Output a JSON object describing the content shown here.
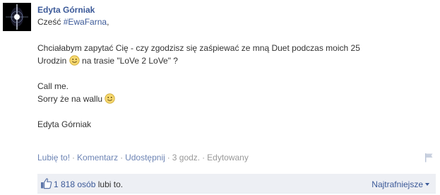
{
  "post": {
    "author": "Edyta Górniak",
    "greeting_prefix": "Cześć ",
    "hashtag": "#EwaFarna",
    "greeting_suffix": ",",
    "body_line1": "Chciałabym zapytać Cię - czy zgodzisz się zaśpiewać ze mną Duet podczas moich 25",
    "body_line2_a": "Urodzin ",
    "body_line2_b": " na trasie \"LoVe 2 LoVe\" ?",
    "call_me": "Call me.",
    "sorry_text": "Sorry że na wallu ",
    "signature": "Edyta Górniak"
  },
  "actions": {
    "like": "Lubię to!",
    "comment": "Komentarz",
    "share": "Udostępnij",
    "time": "3 godz.",
    "edited": "Edytowany",
    "separator": "·"
  },
  "likes": {
    "count": "1 818 osób",
    "suffix": " lubi to.",
    "sort_label": "Najtrafniejsze"
  },
  "icons": {
    "avatar": "avatar-image",
    "smiley": "smiley-icon",
    "flag": "flag-icon",
    "thumb": "thumbs-up-icon",
    "caret": "caret-down-icon"
  },
  "colors": {
    "link": "#3b5998",
    "muted": "#999999",
    "bar": "#edeff4"
  }
}
